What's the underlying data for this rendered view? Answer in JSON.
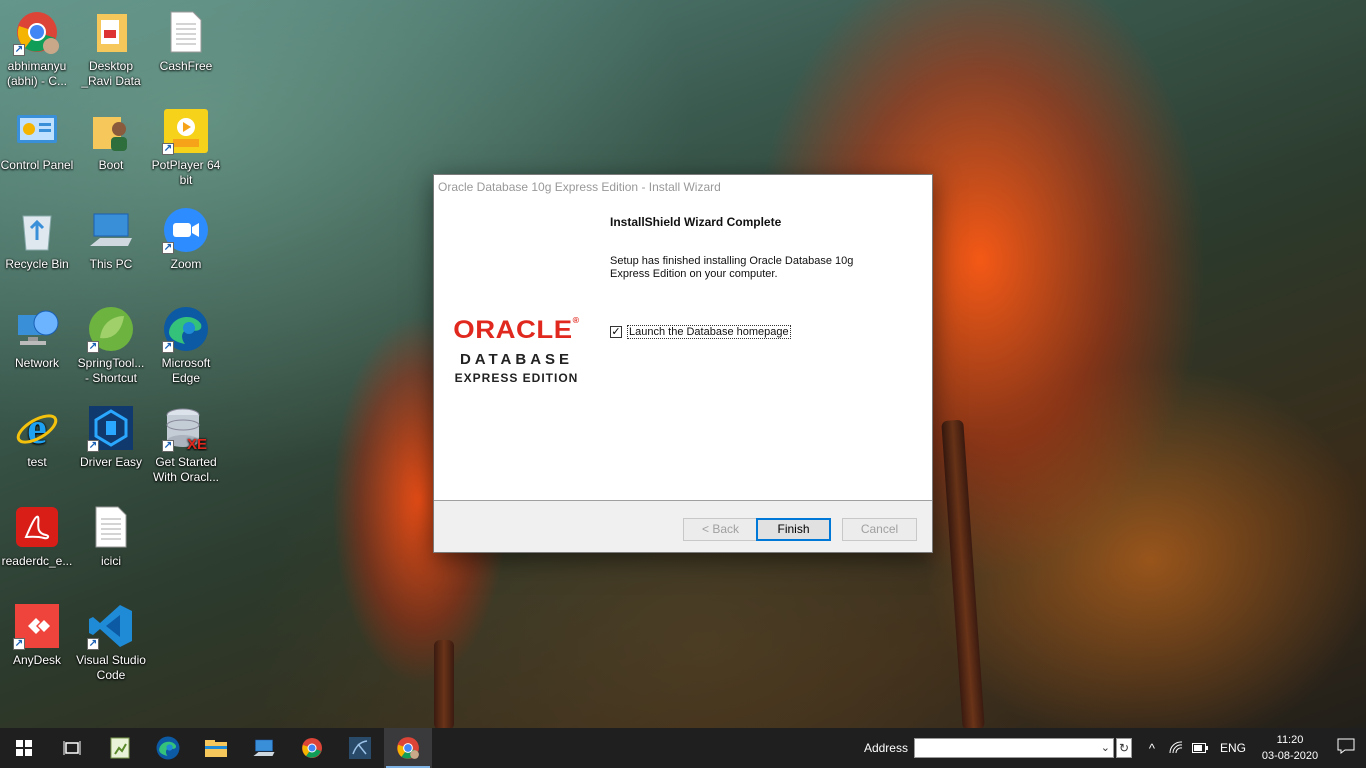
{
  "desktop": {
    "icons": [
      {
        "label": "abhimanyu (abhi) - C...",
        "icon": "chrome-icon"
      },
      {
        "label": "Desktop _Ravi Data",
        "icon": "folder-icon"
      },
      {
        "label": "CashFree",
        "icon": "document-icon"
      },
      {
        "label": "Control Panel",
        "icon": "control-panel-icon"
      },
      {
        "label": "Boot",
        "icon": "folder-user-icon"
      },
      {
        "label": "PotPlayer 64 bit",
        "icon": "potplayer-icon"
      },
      {
        "label": "Recycle Bin",
        "icon": "recycle-bin-icon"
      },
      {
        "label": "This PC",
        "icon": "this-pc-icon"
      },
      {
        "label": "Zoom",
        "icon": "zoom-icon"
      },
      {
        "label": "Network",
        "icon": "network-icon"
      },
      {
        "label": "SpringTool... - Shortcut",
        "icon": "spring-tool-icon"
      },
      {
        "label": "Microsoft Edge",
        "icon": "edge-icon"
      },
      {
        "label": "test",
        "icon": "internet-explorer-icon"
      },
      {
        "label": "Driver Easy",
        "icon": "driver-easy-icon"
      },
      {
        "label": "Get Started With Oracl...",
        "icon": "oracle-xe-icon"
      },
      {
        "label": "readerdc_e...",
        "icon": "acrobat-icon"
      },
      {
        "label": "icici",
        "icon": "document-icon"
      },
      {
        "label": "AnyDesk",
        "icon": "anydesk-icon"
      },
      {
        "label": "Visual Studio Code",
        "icon": "vscode-icon"
      }
    ]
  },
  "dialog": {
    "title": "Oracle Database 10g Express Edition - Install Wizard",
    "logo": {
      "brand": "ORACLE",
      "product": "DATABASE",
      "edition": "EXPRESS EDITION"
    },
    "heading": "InstallShield Wizard Complete",
    "message": "Setup has finished installing Oracle Database 10g Express Edition on your computer.",
    "checkbox_label": "Launch the Database homepage",
    "checkbox_checked": true,
    "back_label": "< Back",
    "finish_label": "Finish",
    "cancel_label": "Cancel"
  },
  "taskbar": {
    "apps": [
      "start-icon",
      "task-view-icon",
      "notepad-plus-icon",
      "edge-icon",
      "file-explorer-icon",
      "this-pc-icon",
      "chrome-icon",
      "sql-developer-icon",
      "chrome-profile-icon"
    ],
    "address_label": "Address",
    "address_value": "",
    "language": "ENG",
    "time": "11:20",
    "date": "03-08-2020"
  },
  "colors": {
    "oracle_red": "#e0281e",
    "accent": "#0078d7",
    "taskbar": "#1f1f20"
  }
}
